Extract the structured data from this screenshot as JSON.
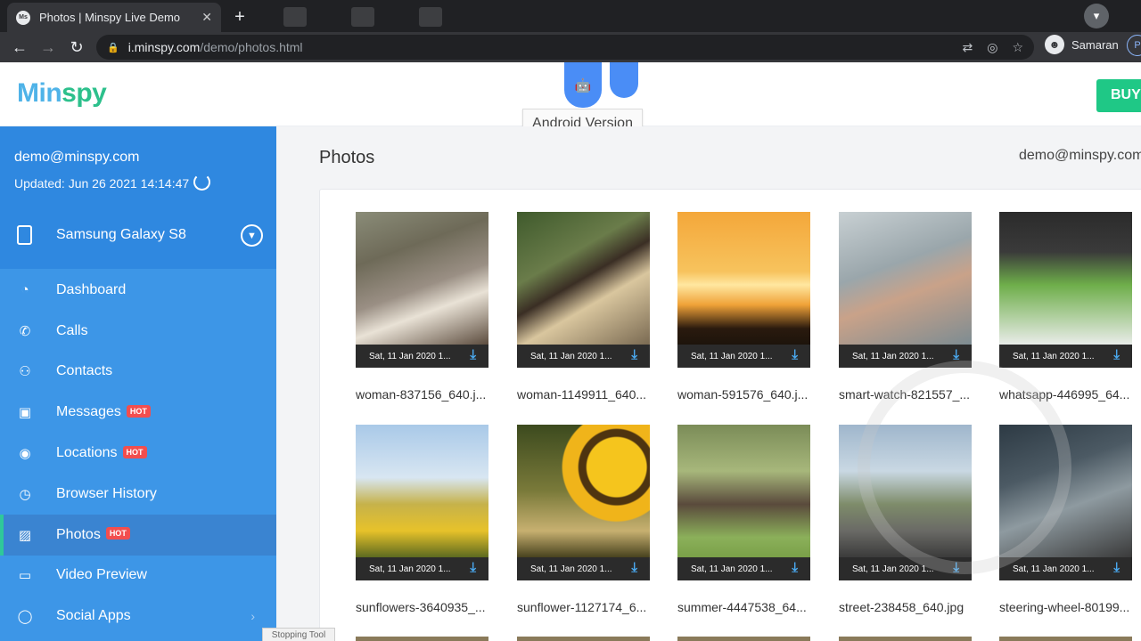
{
  "browser": {
    "tab_title": "Photos | Minspy Live Demo",
    "tab_favicon": "Ms",
    "url_host": "i.minspy.com",
    "url_path": "/demo/photos.html",
    "profile_name": "Samaran",
    "icons": [
      "translate-icon",
      "eye-off-icon",
      "star-icon"
    ]
  },
  "header": {
    "logo_main": "Min",
    "logo_accent": "spy",
    "android_tooltip": "Android Version",
    "buy_label": "BUY"
  },
  "sidebar": {
    "email": "demo@minspy.com",
    "updated": "Updated: Jun 26 2021 14:14:47",
    "device": "Samsung Galaxy S8",
    "items": [
      {
        "label": "Dashboard",
        "icon": "dashboard-icon",
        "hot": ""
      },
      {
        "label": "Calls",
        "icon": "phone-icon",
        "hot": ""
      },
      {
        "label": "Contacts",
        "icon": "contact-icon",
        "hot": ""
      },
      {
        "label": "Messages",
        "icon": "message-icon",
        "hot": "HOT"
      },
      {
        "label": "Locations",
        "icon": "location-icon",
        "hot": "HOT"
      },
      {
        "label": "Browser History",
        "icon": "clock-icon",
        "hot": ""
      },
      {
        "label": "Photos",
        "icon": "image-icon",
        "hot": "HOT"
      },
      {
        "label": "Video Preview",
        "icon": "video-icon",
        "hot": ""
      },
      {
        "label": "Social Apps",
        "icon": "chat-icon",
        "hot": ""
      }
    ],
    "tooltip": "Stopping Tool"
  },
  "main": {
    "title": "Photos",
    "email": "demo@minspy.com",
    "photos": [
      {
        "date": "Sat, 11 Jan 2020 1...",
        "name": "woman-837156_640.j..."
      },
      {
        "date": "Sat, 11 Jan 2020 1...",
        "name": "woman-1149911_640..."
      },
      {
        "date": "Sat, 11 Jan 2020 1...",
        "name": "woman-591576_640.j..."
      },
      {
        "date": "Sat, 11 Jan 2020 1...",
        "name": "smart-watch-821557_..."
      },
      {
        "date": "Sat, 11 Jan 2020 1...",
        "name": "whatsapp-446995_64..."
      },
      {
        "date": "Sat, 11 Jan 2020 1...",
        "name": "sunflowers-3640935_..."
      },
      {
        "date": "Sat, 11 Jan 2020 1...",
        "name": "sunflower-1127174_6..."
      },
      {
        "date": "Sat, 11 Jan 2020 1...",
        "name": "summer-4447538_64..."
      },
      {
        "date": "Sat, 11 Jan 2020 1...",
        "name": "street-238458_640.jpg"
      },
      {
        "date": "Sat, 11 Jan 2020 1...",
        "name": "steering-wheel-80199..."
      }
    ]
  },
  "colors": {
    "sidebar": "#3d96e7",
    "accent_green": "#1fc886",
    "hot_badge": "#f24e4e"
  }
}
